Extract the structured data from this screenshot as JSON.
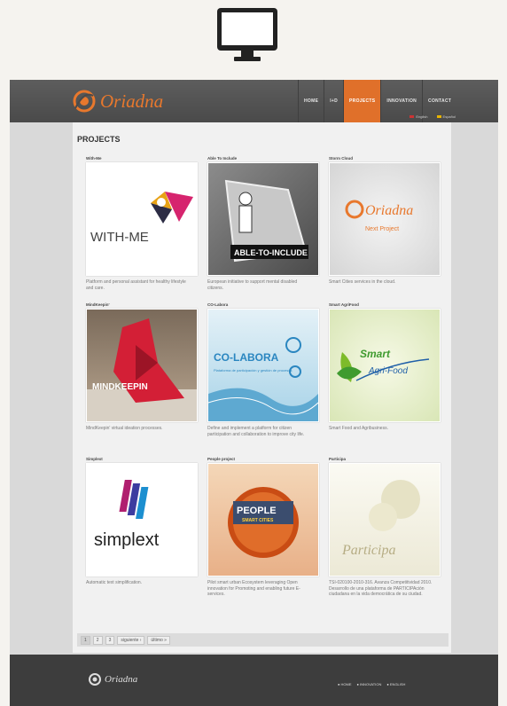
{
  "header": {
    "logo_text": "Oriadna",
    "nav": [
      "HOME",
      "I+D",
      "PROJECTS",
      "INNOVATION",
      "CONTACT"
    ],
    "active_nav": "PROJECTS",
    "languages": [
      "English",
      "Español"
    ]
  },
  "page": {
    "title": "PROJECTS"
  },
  "projects": [
    {
      "title": "With-Me",
      "desc": "Platform and personal assistant for healthy lifestyle and care."
    },
    {
      "title": "Able To Include",
      "desc": "European initiative to support mental disabled citizens."
    },
    {
      "title": "Storm Cloud",
      "desc": "Smart Cities services in the cloud."
    },
    {
      "title": "MindKeepin'",
      "desc": "MindKeepin' virtual ideation processes."
    },
    {
      "title": "CO-Labora",
      "desc": "Define and implement a platform for citizen participation and collaboration to improve city life."
    },
    {
      "title": "Smart AgriFood",
      "desc": "Smart Food and Agribusiness."
    },
    {
      "title": "Simplext",
      "desc": "Automatic text simplification."
    },
    {
      "title": "People project",
      "desc": "Pilot smart urban Ecosystem leveraging Open innovation for Promoting and enabling future E-services."
    },
    {
      "title": "Participa",
      "desc": "TSI-020100-2010-316. Avanza Competitividad 2010. Desarrollo de una plataforma de PARTICIPAción ciudadana en la vida democrática de su ciudad."
    }
  ],
  "thumb_labels": {
    "withme": "WITH-ME",
    "abletoinclude": "ABLE-TO-INCLUDE",
    "stormcloud_logo": "Oriadna",
    "stormcloud_sub": "Next Project",
    "mindkeepin": "MINDKEEPIN",
    "colabora": "CO-LABORA",
    "colabora_sub": "Plataforma de participación y gestión de procesos",
    "smart": "Smart",
    "agrifood": "Agri-Food",
    "simplext": "simplext",
    "people": "PEOPLE",
    "people_sub": "SMART CITIES",
    "participa": "Participa"
  },
  "pager": {
    "pages": [
      "1",
      "2",
      "3"
    ],
    "next": "siguiente ›",
    "last": "último »"
  },
  "footer": {
    "logo_text": "Oriadna",
    "links": [
      "● HOME",
      "● INNOVATION",
      "● ENGLISH"
    ]
  },
  "colors": {
    "accent": "#e0702a",
    "header": "#4f4f4f",
    "footer": "#3d3d3d"
  }
}
